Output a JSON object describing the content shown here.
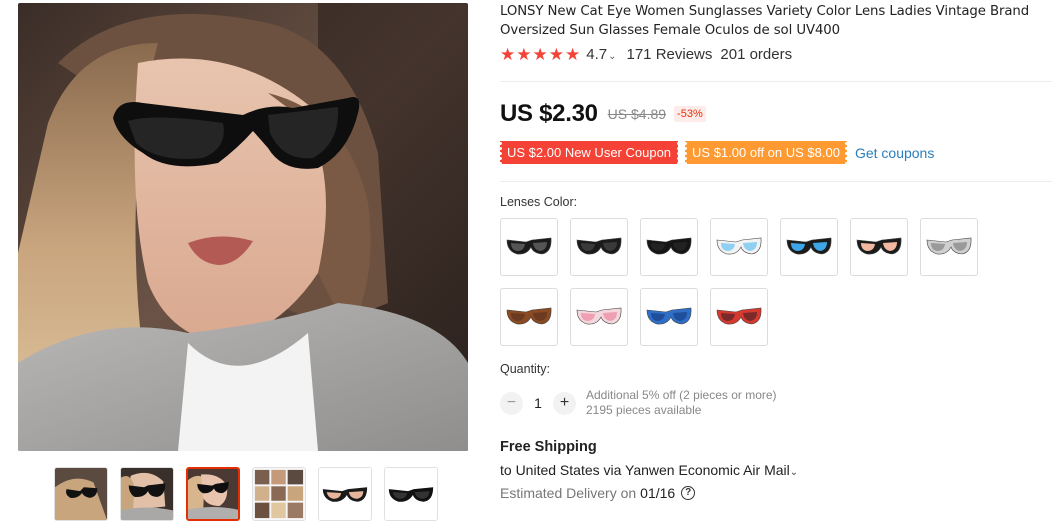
{
  "product": {
    "title": "LONSY New Cat Eye Women Sunglasses Variety Color Lens Ladies Vintage Brand Oversized Sun Glasses Female Oculos de sol UV400",
    "rating": "4.7",
    "reviews": "171 Reviews",
    "orders": "201 orders",
    "stars_filled": 5
  },
  "price": {
    "current": "US $2.30",
    "original": "US $4.89",
    "discount": "-53%"
  },
  "coupons": {
    "new_user": "US $2.00 New User Coupon",
    "store": "US $1.00 off on US $8.00",
    "get_label": "Get coupons"
  },
  "variants": {
    "label": "Lenses Color:",
    "swatches": [
      {
        "name": "black-gradient",
        "frame": "#1b1b1b",
        "lens": "#555555"
      },
      {
        "name": "black-grey",
        "frame": "#1b1b1b",
        "lens": "#3a3a3a"
      },
      {
        "name": "all-black",
        "frame": "#151515",
        "lens": "#222222"
      },
      {
        "name": "white-blue",
        "frame": "#f2f2f2",
        "lens": "#8fd0f2"
      },
      {
        "name": "black-blue",
        "frame": "#1b1b1b",
        "lens": "#3da6e8"
      },
      {
        "name": "black-pink",
        "frame": "#1b1b1b",
        "lens": "#f2b9a0"
      },
      {
        "name": "clear-grey",
        "frame": "#cfcfcf",
        "lens": "#9a9a9a"
      },
      {
        "name": "leopard-brown",
        "frame": "#8a4a22",
        "lens": "#6b3a20"
      },
      {
        "name": "clear-pink",
        "frame": "#f3d7dc",
        "lens": "#ee9fb1"
      },
      {
        "name": "blue",
        "frame": "#2f6fc7",
        "lens": "#1f4f9a"
      },
      {
        "name": "red",
        "frame": "#d63a2e",
        "lens": "#7a2a2a"
      }
    ]
  },
  "quantity": {
    "label": "Quantity:",
    "value": "1",
    "minus": "−",
    "plus": "+",
    "offer": "Additional 5% off (2 pieces or more)",
    "available": "2195 pieces available"
  },
  "shipping": {
    "title": "Free Shipping",
    "route": "to United States via Yanwen Economic Air Mail",
    "eta_label": "Estimated Delivery on",
    "eta_date": "01/16",
    "help_icon": "?"
  },
  "icons": {
    "star": "star-icon",
    "chevron": "chevron-down-icon",
    "help": "question-circle-icon"
  },
  "colors": {
    "accent_red": "#f44336",
    "coupon_orange": "#ff9a33",
    "link_blue": "#2a7ebd"
  },
  "gallery": {
    "active_thumb": 2,
    "thumb_count": 6
  }
}
